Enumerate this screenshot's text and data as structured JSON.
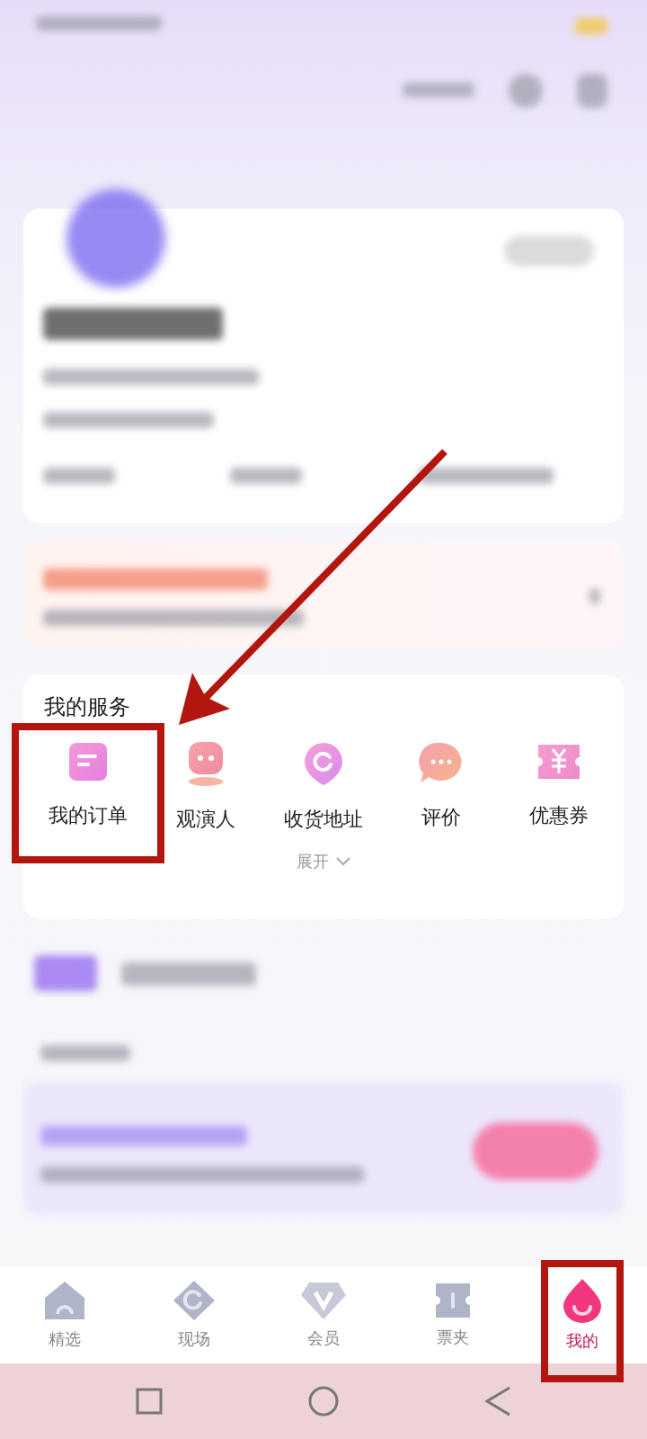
{
  "services": {
    "title": "我的服务",
    "items": [
      {
        "kind": "order",
        "label": "我的订单",
        "highlighted": true
      },
      {
        "kind": "viewer",
        "label": "观演人",
        "highlighted": false
      },
      {
        "kind": "address",
        "label": "收货地址",
        "highlighted": false
      },
      {
        "kind": "review",
        "label": "评价",
        "highlighted": false
      },
      {
        "kind": "coupon",
        "label": "优惠券",
        "highlighted": false
      }
    ],
    "expand": "展开"
  },
  "tab_bar": [
    {
      "kind": "home",
      "label": "精选",
      "selected": false,
      "highlighted": false
    },
    {
      "kind": "live",
      "label": "现场",
      "selected": false,
      "highlighted": false
    },
    {
      "kind": "member",
      "label": "会员",
      "selected": false,
      "highlighted": false
    },
    {
      "kind": "tickets",
      "label": "票夹",
      "selected": false,
      "highlighted": false
    },
    {
      "kind": "mine",
      "label": "我的",
      "selected": true,
      "highlighted": true
    }
  ]
}
